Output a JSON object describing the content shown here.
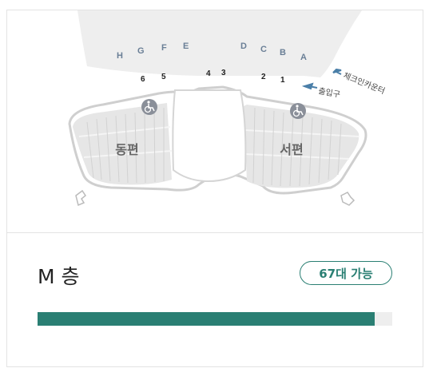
{
  "map": {
    "gate_letters": [
      "H",
      "G",
      "F",
      "E",
      "D",
      "C",
      "B",
      "A"
    ],
    "gate_numbers": [
      "6",
      "5",
      "4",
      "3",
      "2",
      "1"
    ],
    "checkin_label": "체크인카운터",
    "exit_label": "출입구",
    "east_label": "동편",
    "west_label": "서편",
    "accessible_icon": "wheelchair-icon",
    "colors": {
      "terminal_fill": "#eeeeee",
      "parking_fill": "#e6e6e6",
      "outline": "#cfcfcf",
      "label": "#6a7f96",
      "accessible_badge": "#8a8f99"
    }
  },
  "floor": {
    "title": "M 층",
    "availability": "67대 가능",
    "occupancy_fraction": 0.95
  },
  "colors": {
    "accent": "#2a7f73",
    "track": "#eeeeee"
  }
}
